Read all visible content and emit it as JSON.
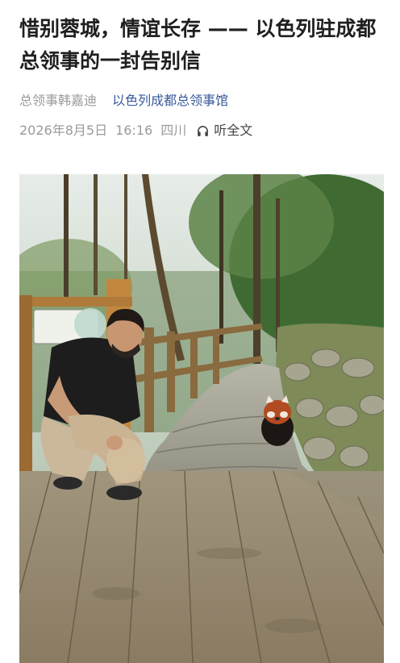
{
  "article": {
    "title": "惜别蓉城，情谊长存 —— 以色列驻成都总领事的一封告别信",
    "author": "总领事韩嘉迪",
    "organization": "以色列成都总领事馆",
    "date": "2026年8月5日",
    "time": "16:16",
    "region": "四川",
    "listen_label": "听全文",
    "listen_icon": "headphones-icon"
  },
  "photo": {
    "alt": "man-crouching-with-red-panda"
  },
  "colors": {
    "title": "#1f1f1f",
    "muted": "#9a9a9a",
    "link": "#3a5a9a"
  }
}
